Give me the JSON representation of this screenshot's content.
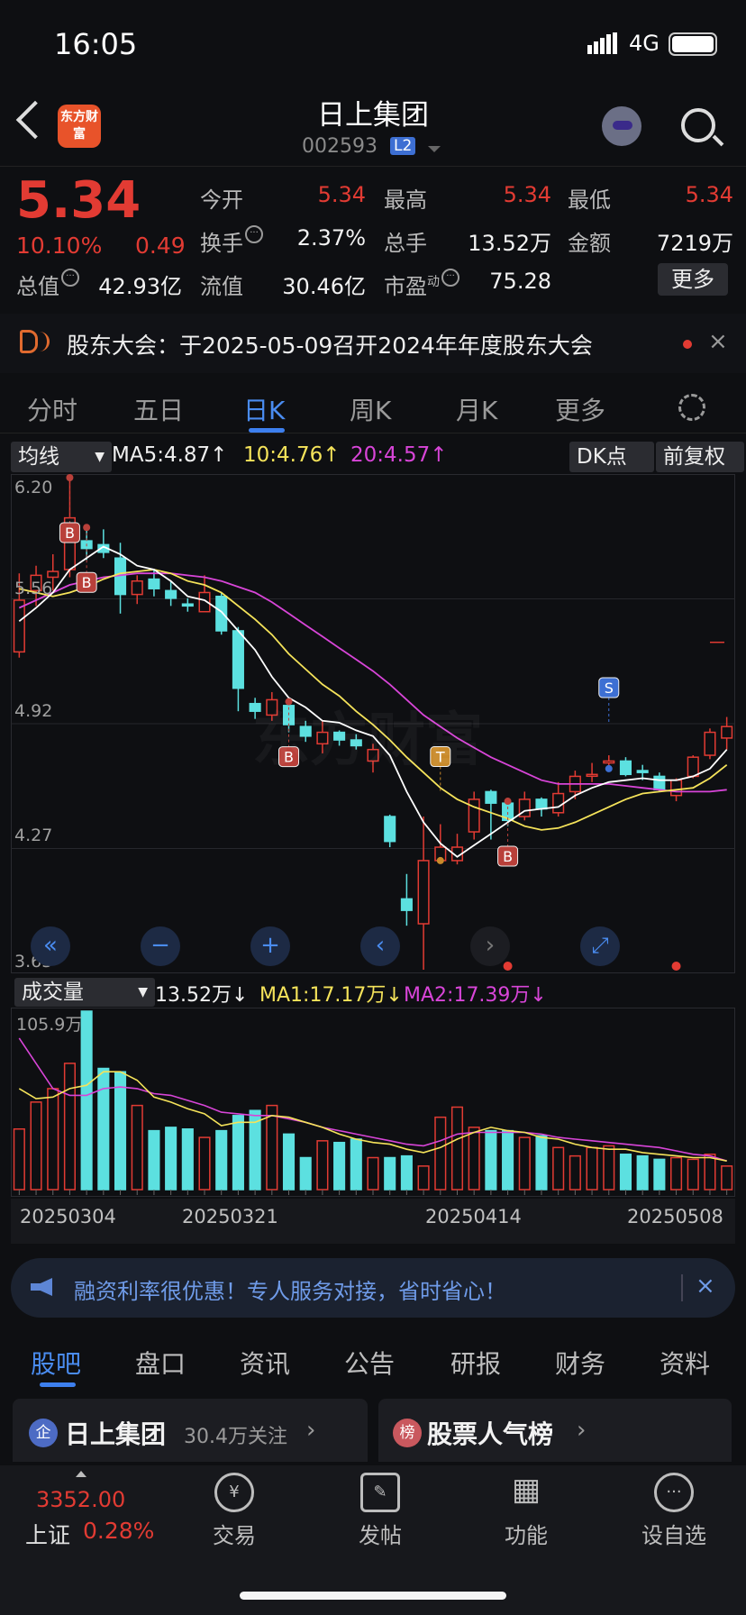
{
  "status": {
    "time": "16:05",
    "network": "4G"
  },
  "header": {
    "stock_name": "日上集团",
    "stock_code": "002593",
    "level_badge": "L2",
    "logo_text": "东方财富"
  },
  "quote": {
    "price": "5.34",
    "change_pct": "10.10%",
    "change": "0.49",
    "today_open_label": "今开",
    "today_open": "5.34",
    "high_label": "最高",
    "high": "5.34",
    "low_label": "最低",
    "low": "5.34",
    "turnover_label": "换手",
    "turnover": "2.37%",
    "volume_label": "总手",
    "volume": "13.52万",
    "amount_label": "金额",
    "amount": "7219万",
    "mktcap_label": "总值",
    "mktcap": "42.93亿",
    "float_label": "流值",
    "float": "30.46亿",
    "pe_label": "市盈",
    "pe_sup": "动",
    "pe": "75.28",
    "more_label": "更多"
  },
  "notice": {
    "text": "股东大会：于2025-05-09召开2024年年度股东大会",
    "close": "×"
  },
  "period_tabs": [
    "分时",
    "五日",
    "日K",
    "周K",
    "月K",
    "更多"
  ],
  "ma_row": {
    "chip": "均线",
    "ma5": "MA5:4.87↑",
    "ma10": "10:4.76↑",
    "ma20": "20:4.57↑",
    "dk": "DK点",
    "adjust": "前复权"
  },
  "y_axis": [
    "6.20",
    "5.56",
    "4.92",
    "4.27",
    "3.63"
  ],
  "vol_row": {
    "chip": "成交量",
    "value": "13.52万↓",
    "ma1": "MA1:17.17万↓",
    "ma2": "MA2:17.39万↓",
    "max": "105.9万"
  },
  "dates": [
    "20250304",
    "20250321",
    "20250414",
    "20250508"
  ],
  "chart_data": {
    "type": "candlestick",
    "ylim": [
      3.63,
      6.2
    ],
    "candles": [
      {
        "o": 5.29,
        "c": 5.56,
        "h": 5.7,
        "l": 5.26
      },
      {
        "o": 5.61,
        "c": 5.69,
        "h": 5.74,
        "l": 5.53
      },
      {
        "o": 5.68,
        "c": 5.71,
        "h": 5.8,
        "l": 5.61
      },
      {
        "o": 5.72,
        "c": 5.99,
        "h": 6.2,
        "l": 5.68
      },
      {
        "o": 5.87,
        "c": 5.83,
        "h": 5.94,
        "l": 5.77
      },
      {
        "o": 5.85,
        "c": 5.81,
        "h": 5.93,
        "l": 5.78
      },
      {
        "o": 5.78,
        "c": 5.59,
        "h": 5.86,
        "l": 5.49
      },
      {
        "o": 5.59,
        "c": 5.66,
        "h": 5.69,
        "l": 5.54
      },
      {
        "o": 5.67,
        "c": 5.62,
        "h": 5.72,
        "l": 5.58
      },
      {
        "o": 5.61,
        "c": 5.57,
        "h": 5.66,
        "l": 5.53
      },
      {
        "o": 5.54,
        "c": 5.53,
        "h": 5.57,
        "l": 5.5
      },
      {
        "o": 5.5,
        "c": 5.6,
        "h": 5.69,
        "l": 5.5
      },
      {
        "o": 5.58,
        "c": 5.4,
        "h": 5.6,
        "l": 5.38
      },
      {
        "o": 5.4,
        "c": 5.1,
        "h": 5.42,
        "l": 4.98
      },
      {
        "o": 5.02,
        "c": 4.98,
        "h": 5.05,
        "l": 4.94
      },
      {
        "o": 4.96,
        "c": 5.04,
        "h": 5.08,
        "l": 4.93
      },
      {
        "o": 5.01,
        "c": 4.91,
        "h": 5.03,
        "l": 4.87
      },
      {
        "o": 4.9,
        "c": 4.85,
        "h": 4.93,
        "l": 4.82
      },
      {
        "o": 4.81,
        "c": 4.87,
        "h": 4.93,
        "l": 4.76
      },
      {
        "o": 4.87,
        "c": 4.83,
        "h": 4.88,
        "l": 4.8
      },
      {
        "o": 4.83,
        "c": 4.8,
        "h": 4.86,
        "l": 4.78
      },
      {
        "o": 4.72,
        "c": 4.78,
        "h": 4.81,
        "l": 4.66
      },
      {
        "o": 4.43,
        "c": 4.3,
        "h": 4.44,
        "l": 4.27
      },
      {
        "o": 4.0,
        "c": 3.94,
        "h": 4.13,
        "l": 3.86
      },
      {
        "o": 3.87,
        "c": 4.2,
        "h": 4.43,
        "l": 3.63
      },
      {
        "o": 4.2,
        "c": 4.27,
        "h": 4.39,
        "l": 4.2
      },
      {
        "o": 4.2,
        "c": 4.27,
        "h": 4.34,
        "l": 4.18
      },
      {
        "o": 4.35,
        "c": 4.52,
        "h": 4.56,
        "l": 4.31
      },
      {
        "o": 4.56,
        "c": 4.5,
        "h": 4.57,
        "l": 4.31
      },
      {
        "o": 4.5,
        "c": 4.41,
        "h": 4.51,
        "l": 4.38
      },
      {
        "o": 4.43,
        "c": 4.52,
        "h": 4.56,
        "l": 4.41
      },
      {
        "o": 4.52,
        "c": 4.47,
        "h": 4.53,
        "l": 4.43
      },
      {
        "o": 4.45,
        "c": 4.55,
        "h": 4.61,
        "l": 4.43
      },
      {
        "o": 4.56,
        "c": 4.64,
        "h": 4.67,
        "l": 4.52
      },
      {
        "o": 4.65,
        "c": 4.65,
        "h": 4.71,
        "l": 4.61
      },
      {
        "o": 4.71,
        "c": 4.72,
        "h": 4.75,
        "l": 4.68
      },
      {
        "o": 4.72,
        "c": 4.65,
        "h": 4.74,
        "l": 4.64
      },
      {
        "o": 4.67,
        "c": 4.66,
        "h": 4.7,
        "l": 4.62
      },
      {
        "o": 4.64,
        "c": 4.57,
        "h": 4.66,
        "l": 4.56
      },
      {
        "o": 4.54,
        "c": 4.62,
        "h": 4.63,
        "l": 4.51
      },
      {
        "o": 4.64,
        "c": 4.74,
        "h": 4.75,
        "l": 4.63
      },
      {
        "o": 4.75,
        "c": 4.87,
        "h": 4.89,
        "l": 4.73
      },
      {
        "o": 4.84,
        "c": 4.9,
        "h": 4.95,
        "l": 4.78
      }
    ],
    "ma5": [
      5.45,
      5.52,
      5.6,
      5.72,
      5.78,
      5.84,
      5.8,
      5.74,
      5.72,
      5.66,
      5.58,
      5.56,
      5.5,
      5.4,
      5.3,
      5.16,
      5.05,
      5.0,
      4.93,
      4.92,
      4.88,
      4.85,
      4.75,
      4.56,
      4.4,
      4.29,
      4.22,
      4.28,
      4.34,
      4.4,
      4.46,
      4.47,
      4.48,
      4.54,
      4.58,
      4.61,
      4.62,
      4.63,
      4.62,
      4.62,
      4.64,
      4.68,
      4.78
    ],
    "ma10": [
      5.62,
      5.6,
      5.58,
      5.6,
      5.63,
      5.67,
      5.7,
      5.71,
      5.72,
      5.7,
      5.66,
      5.64,
      5.6,
      5.53,
      5.46,
      5.38,
      5.28,
      5.2,
      5.12,
      5.06,
      4.98,
      4.91,
      4.83,
      4.74,
      4.66,
      4.58,
      4.52,
      4.48,
      4.45,
      4.42,
      4.38,
      4.36,
      4.37,
      4.4,
      4.44,
      4.48,
      4.52,
      4.55,
      4.56,
      4.57,
      4.58,
      4.63,
      4.7
    ],
    "ma20": [
      5.52,
      5.56,
      5.6,
      5.64,
      5.66,
      5.68,
      5.69,
      5.7,
      5.7,
      5.7,
      5.69,
      5.68,
      5.66,
      5.63,
      5.6,
      5.55,
      5.49,
      5.43,
      5.37,
      5.31,
      5.25,
      5.19,
      5.12,
      5.04,
      4.96,
      4.9,
      4.84,
      4.79,
      4.74,
      4.7,
      4.66,
      4.62,
      4.6,
      4.6,
      4.6,
      4.6,
      4.59,
      4.58,
      4.57,
      4.56,
      4.56,
      4.56,
      4.57
    ],
    "signals": [
      {
        "i": 3,
        "label": "B",
        "type": "buy",
        "dir": "down"
      },
      {
        "i": 4,
        "label": "B",
        "type": "buy",
        "dir": "down"
      },
      {
        "i": 16,
        "label": "B",
        "type": "buy",
        "dir": "down"
      },
      {
        "i": 25,
        "label": "T",
        "type": "t",
        "dir": "up"
      },
      {
        "i": 29,
        "label": "B",
        "type": "buy",
        "dir": "down"
      },
      {
        "i": 35,
        "label": "S",
        "type": "sell",
        "dir": "up"
      }
    ],
    "volume": [
      36,
      52,
      60,
      75,
      106,
      72,
      70,
      50,
      35,
      37,
      36,
      31,
      35,
      44,
      47,
      50,
      33,
      19,
      29,
      28,
      30,
      19,
      19,
      20,
      14,
      43,
      49,
      37,
      35,
      35,
      31,
      32,
      25,
      20,
      25,
      26,
      21,
      20,
      18,
      19,
      18,
      21,
      14
    ],
    "vol_ma1": [
      60,
      54,
      55,
      60,
      62,
      70,
      70,
      65,
      55,
      52,
      48,
      45,
      38,
      40,
      40,
      44,
      43,
      40,
      37,
      33,
      30,
      28,
      27,
      24,
      22,
      25,
      30,
      34,
      37,
      35,
      34,
      31,
      30,
      27,
      25,
      24,
      24,
      22,
      21,
      20,
      19,
      19,
      17
    ],
    "vol_ma2": [
      90,
      75,
      60,
      56,
      56,
      60,
      61,
      60,
      57,
      56,
      53,
      50,
      46,
      45,
      44,
      44,
      42,
      40,
      37,
      35,
      33,
      31,
      29,
      27,
      26,
      29,
      33,
      34,
      34,
      34,
      34,
      33,
      31,
      30,
      29,
      28,
      27,
      26,
      25,
      23,
      21,
      20,
      17
    ]
  },
  "chart_nav": [
    "«",
    "−",
    "+",
    "‹",
    "›",
    "⤢"
  ],
  "watermark": "东方财富",
  "ad": {
    "text": "融资利率很优惠！专人服务对接，省时省心！",
    "close": "×"
  },
  "bottom_tabs": [
    "股吧",
    "盘口",
    "资讯",
    "公告",
    "研报",
    "财务",
    "资料"
  ],
  "cards": [
    {
      "icon": "企",
      "title": "日上集团",
      "sub": "30.4万关注",
      "arrow": "›"
    },
    {
      "icon": "榜",
      "title": "股票人气榜",
      "arrow": "›"
    }
  ],
  "bottom_nav": {
    "index_value": "3352.00",
    "index_name": "上证",
    "index_pct": "0.28%",
    "items": [
      {
        "label": "交易",
        "glyph": "¥"
      },
      {
        "label": "发帖",
        "glyph": "✎"
      },
      {
        "label": "功能",
        "glyph": "▦"
      },
      {
        "label": "设自选",
        "glyph": "···"
      }
    ]
  },
  "colors": {
    "up": "#e23b33",
    "down": "#5ce0e0",
    "ma5": "#ffffff",
    "ma10": "#f5e35a",
    "ma20": "#d845d8",
    "accent": "#3d7fee"
  }
}
